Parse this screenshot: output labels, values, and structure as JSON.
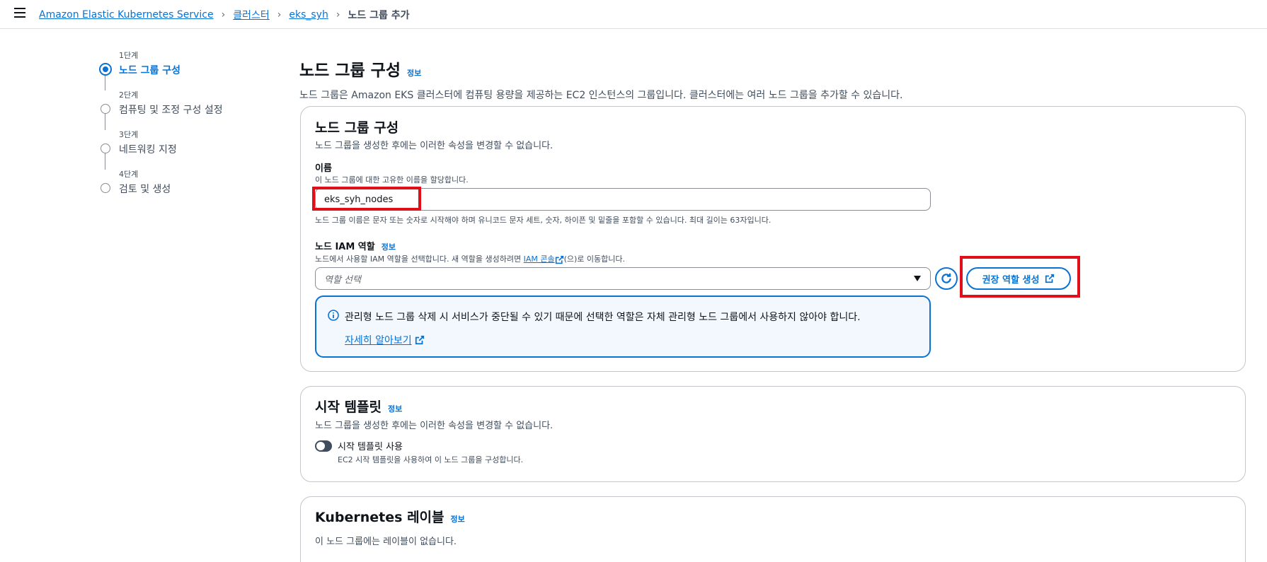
{
  "breadcrumb": {
    "items": [
      "Amazon Elastic Kubernetes Service",
      "클러스터",
      "eks_syh"
    ],
    "current": "노드 그룹 추가"
  },
  "steps": [
    {
      "num": "1단계",
      "title": "노드 그룹 구성"
    },
    {
      "num": "2단계",
      "title": "컴퓨팅 및 조정 구성 설정"
    },
    {
      "num": "3단계",
      "title": "네트워킹 지정"
    },
    {
      "num": "4단계",
      "title": "검토 및 생성"
    }
  ],
  "page": {
    "title": "노드 그룹 구성",
    "info": "정보",
    "description": "노드 그룹은 Amazon EKS 클러스터에 컴퓨팅 용량을 제공하는 EC2 인스턴스의 그룹입니다. 클러스터에는 여러 노드 그룹을 추가할 수 있습니다."
  },
  "config_card": {
    "title": "노드 그룹 구성",
    "subtitle": "노드 그룹을 생성한 후에는 이러한 속성을 변경할 수 없습니다.",
    "name_label": "이름",
    "name_desc": "이 노드 그룹에 대한 고유한 이름을 할당합니다.",
    "name_value": "eks_syh_nodes",
    "name_constraint": "노드 그룹 이름은 문자 또는 숫자로 시작해야 하며 유니코드 문자 세트, 숫자, 하이픈 및 밑줄을 포함할 수 있습니다. 최대 길이는 63자입니다.",
    "iam_label": "노드 IAM 역할",
    "iam_info": "정보",
    "iam_desc_before": "노드에서 사용할 IAM 역할을 선택합니다. 새 역할을 생성하려면 ",
    "iam_desc_link": "IAM 콘솔",
    "iam_desc_after": "(으)로 이동합니다.",
    "iam_placeholder": "역할 선택",
    "create_role_button": "권장 역할 생성",
    "alert_text": "관리형 노드 그룹 삭제 시 서비스가 중단될 수 있기 때문에 선택한 역할은 자체 관리형 노드 그룹에서 사용하지 않아야 합니다.",
    "alert_link": "자세히 알아보기"
  },
  "template_card": {
    "title": "시작 템플릿",
    "info": "정보",
    "subtitle": "노드 그룹을 생성한 후에는 이러한 속성을 변경할 수 없습니다.",
    "toggle_label": "시작 템플릿 사용",
    "toggle_desc": "EC2 시작 템플릿을 사용하여 이 노드 그룹을 구성합니다."
  },
  "labels_card": {
    "title": "Kubernetes 레이블",
    "info": "정보",
    "empty_text": "이 노드 그룹에는 레이블이 없습니다."
  },
  "colors": {
    "accent": "#0972d3",
    "highlight": "#e0101b"
  }
}
